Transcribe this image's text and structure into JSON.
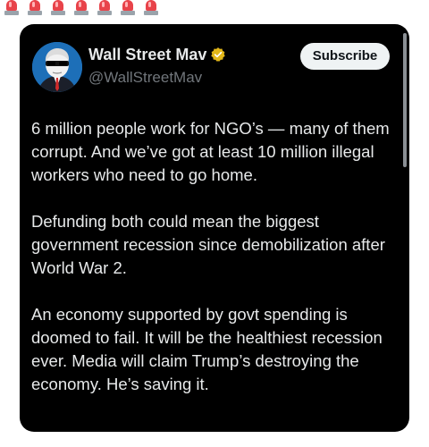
{
  "header": {
    "sirens": [
      "siren-icon",
      "siren-icon",
      "siren-icon",
      "siren-icon",
      "siren-icon",
      "siren-icon",
      "siren-icon"
    ]
  },
  "post": {
    "author_name": "Wall Street Mav",
    "handle": "@WallStreetMav",
    "verified_icon": "gold-verified-badge-icon",
    "subscribe_label": "Subscribe",
    "paragraphs": [
      "6 million people work for NGO’s — many of them corrupt. And we’ve got at least 10 million illegal workers who need to go home.",
      "Defunding both could mean the biggest government recession since demobilization after World War 2.",
      "An economy supported by govt spending is doomed to fail. It will be the healthiest recession ever. Media will claim Trump’s destroying the economy. He’s saving it."
    ]
  },
  "colors": {
    "card_background": "#000000",
    "text_primary": "#e7e9ea",
    "text_secondary": "#71767b",
    "button_background": "#eff3f4",
    "verified_gold": "#e2b719",
    "siren_red": "#e8434a"
  }
}
